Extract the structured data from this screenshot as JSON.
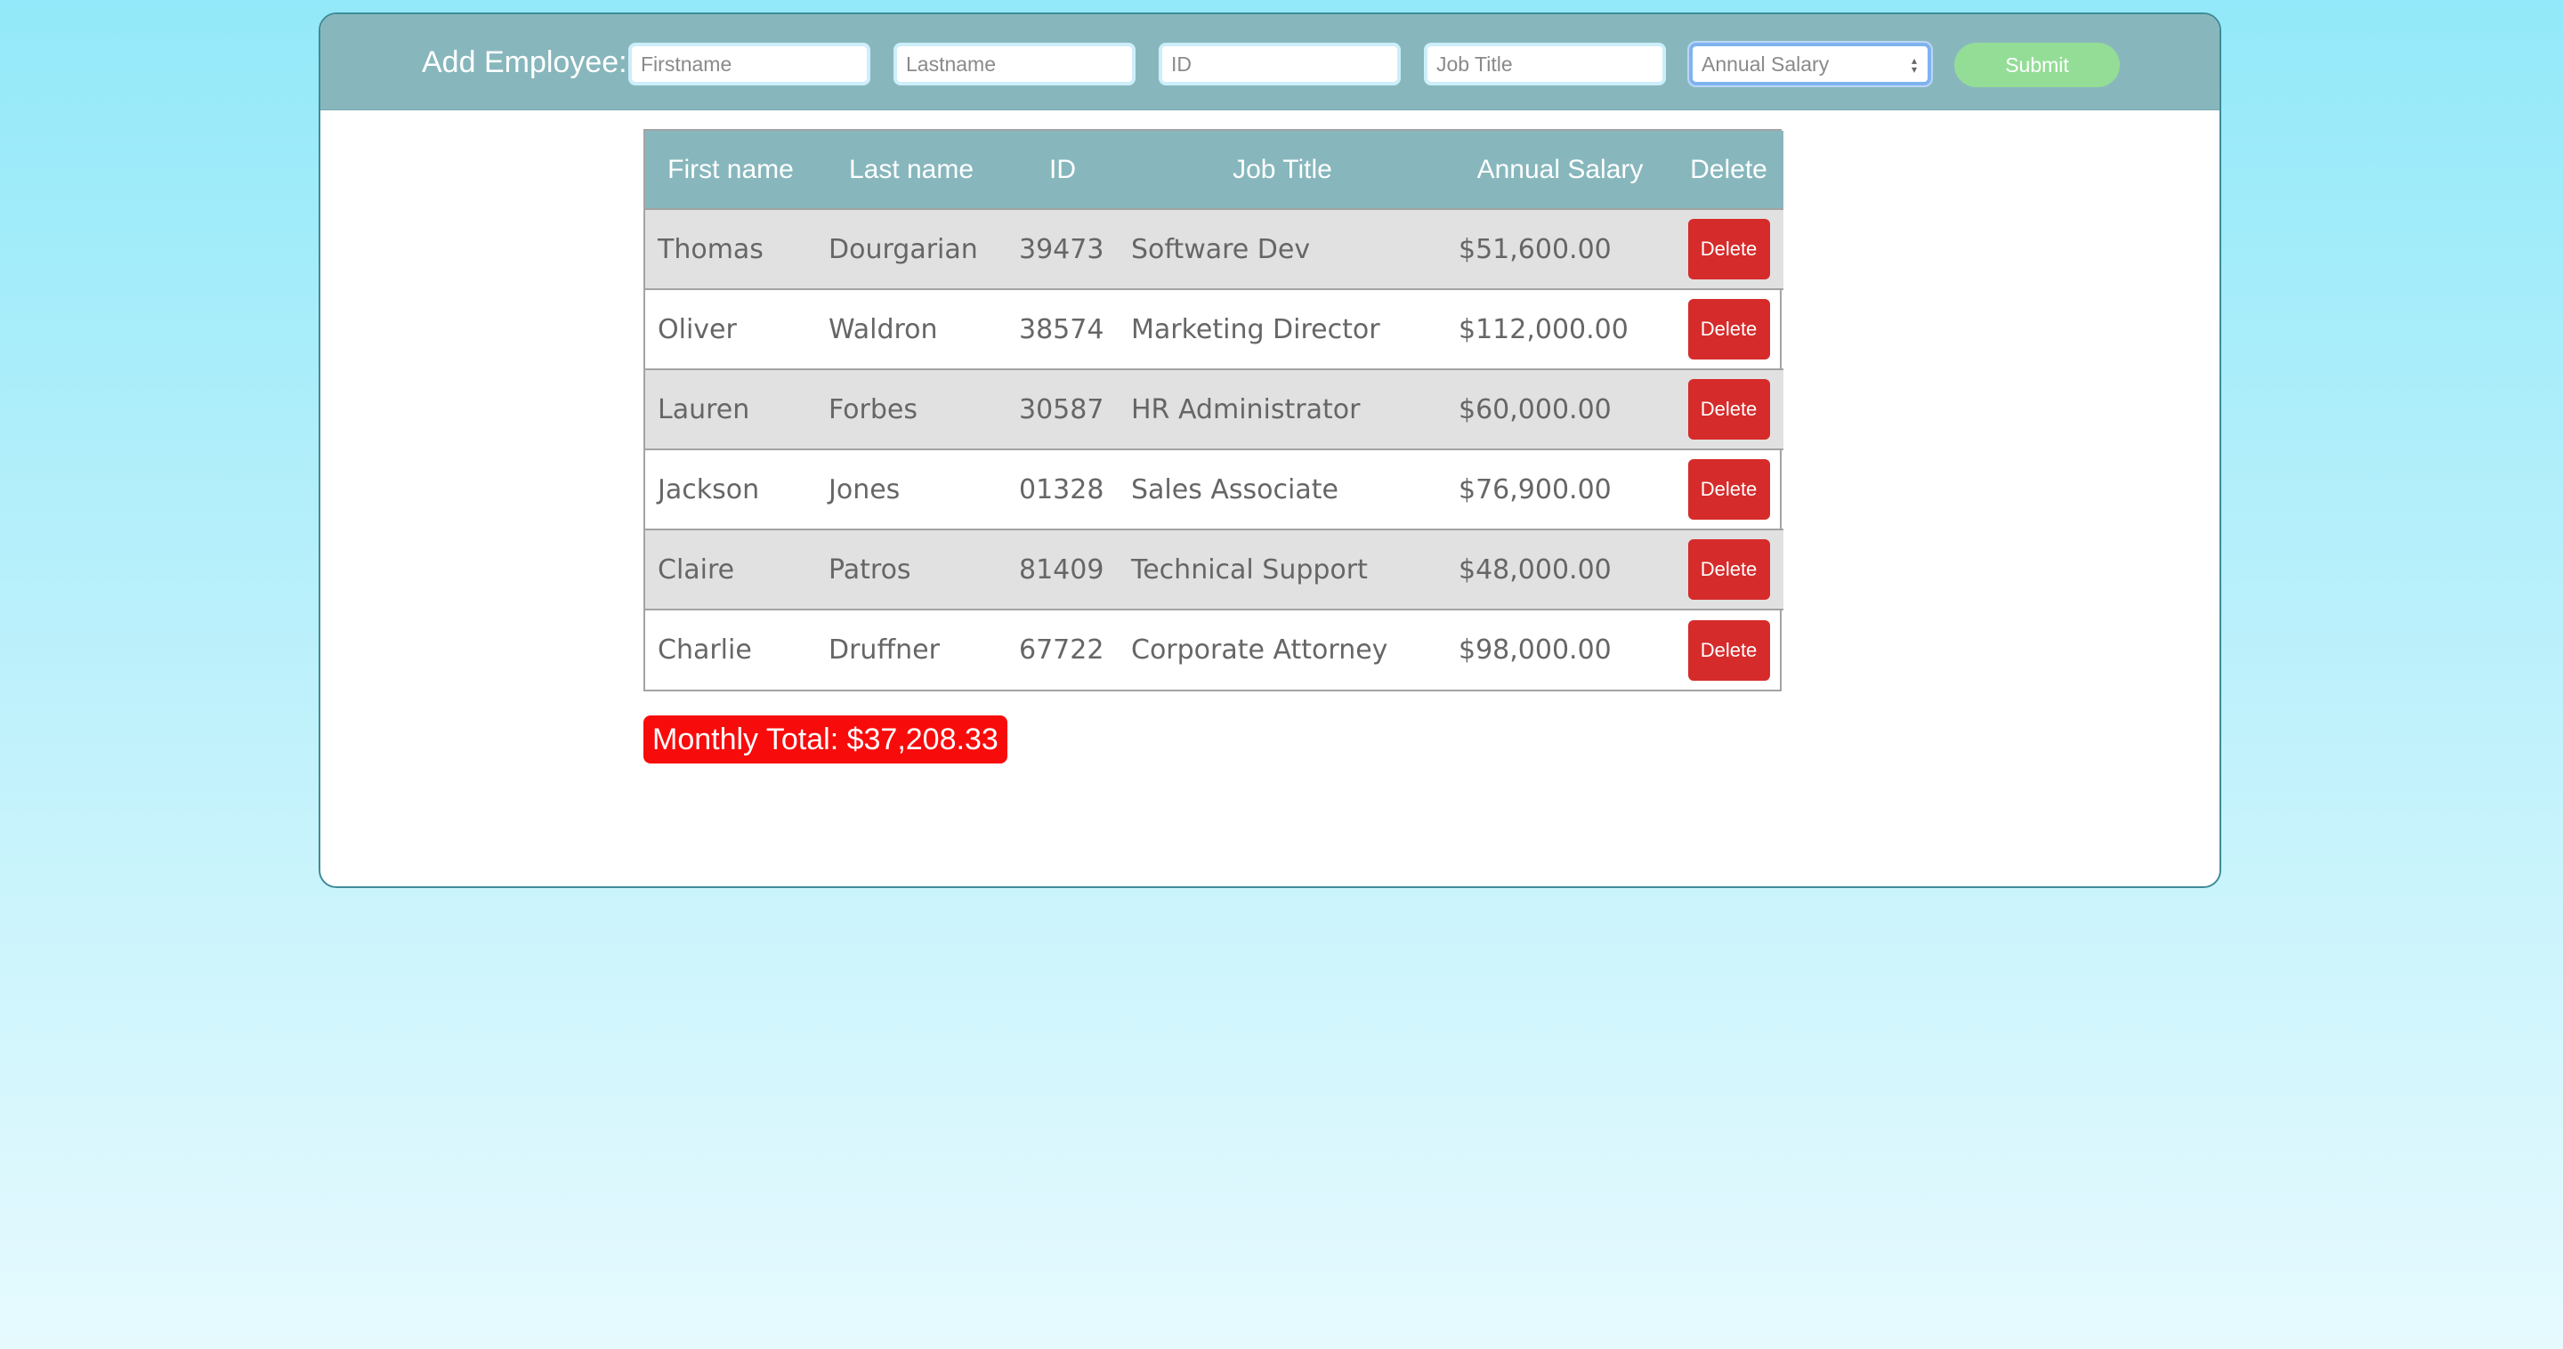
{
  "form": {
    "label": "Add Employee:",
    "fields": [
      {
        "placeholder": "Firstname",
        "value": ""
      },
      {
        "placeholder": "Lastname",
        "value": ""
      },
      {
        "placeholder": "ID",
        "value": ""
      },
      {
        "placeholder": "Job Title",
        "value": ""
      },
      {
        "placeholder": "Annual Salary",
        "value": ""
      }
    ],
    "submit_label": "Submit"
  },
  "table": {
    "headers": [
      "First name",
      "Last name",
      "ID",
      "Job Title",
      "Annual Salary",
      "Delete"
    ],
    "rows": [
      {
        "first": "Thomas",
        "last": "Dourgarian",
        "id": "39473",
        "title": "Software Dev",
        "salary": "$51,600.00",
        "delete_label": "Delete"
      },
      {
        "first": "Oliver",
        "last": "Waldron",
        "id": "38574",
        "title": "Marketing Director",
        "salary": "$112,000.00",
        "delete_label": "Delete"
      },
      {
        "first": "Lauren",
        "last": "Forbes",
        "id": "30587",
        "title": "HR Administrator",
        "salary": "$60,000.00",
        "delete_label": "Delete"
      },
      {
        "first": "Jackson",
        "last": "Jones",
        "id": "01328",
        "title": "Sales Associate",
        "salary": "$76,900.00",
        "delete_label": "Delete"
      },
      {
        "first": "Claire",
        "last": "Patros",
        "id": "81409",
        "title": "Technical Support",
        "salary": "$48,000.00",
        "delete_label": "Delete"
      },
      {
        "first": "Charlie",
        "last": "Druffner",
        "id": "67722",
        "title": "Corporate Attorney",
        "salary": "$98,000.00",
        "delete_label": "Delete"
      }
    ]
  },
  "monthly_total": "Monthly Total: $37,208.33",
  "colors": {
    "header_bg": "#87b7bd",
    "row_shade": "#e1e1e1",
    "delete_button": "#d62b2b",
    "submit_button": "#94dd97",
    "total_badge": "#f80b0b"
  }
}
